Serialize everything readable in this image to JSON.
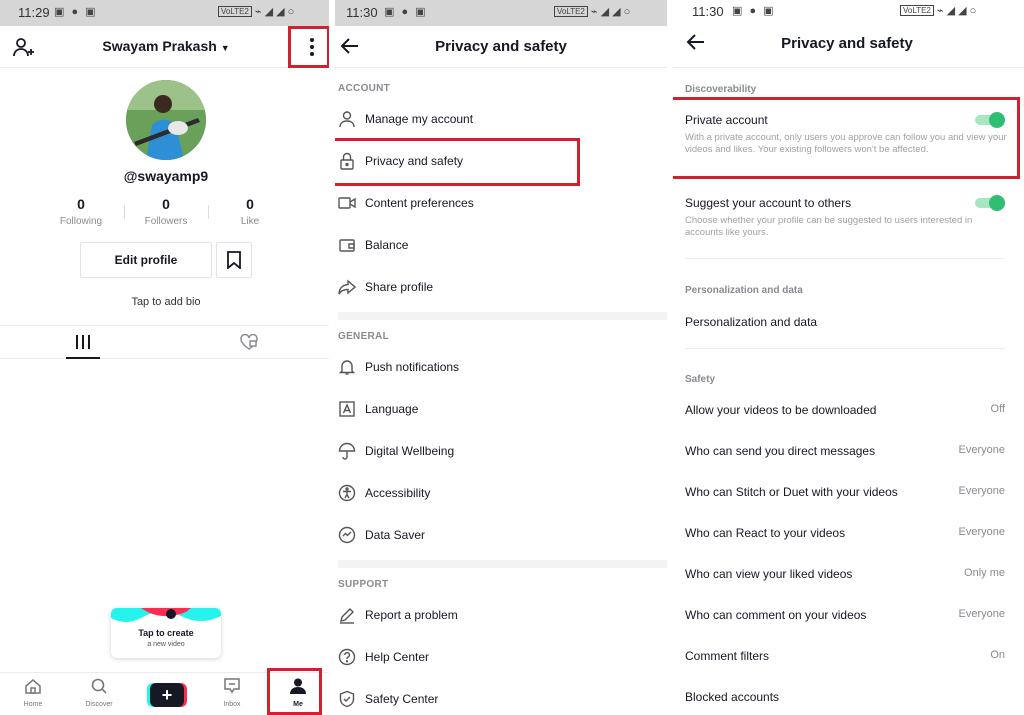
{
  "colors": {
    "highlight": "#d32030",
    "toggle_on": "#2fbe74",
    "toggle_track": "#a7e6c3",
    "text_primary": "#161823",
    "text_secondary": "#8a8b91"
  },
  "profile_screen": {
    "status_time": "11:29",
    "username": "Swayam Prakash",
    "handle": "@swayamp9",
    "stats": [
      {
        "value": "0",
        "label": "Following"
      },
      {
        "value": "0",
        "label": "Followers"
      },
      {
        "value": "0",
        "label": "Like"
      }
    ],
    "edit_profile_label": "Edit profile",
    "bio_placeholder": "Tap to add bio",
    "tooltip": {
      "title": "Tap to create",
      "subtitle": "a new video"
    },
    "nav": {
      "home": "Home",
      "discover": "Discover",
      "create": "+",
      "inbox": "Inbox",
      "me": "Me"
    }
  },
  "privacy_menu": {
    "status_time": "11:30",
    "title": "Privacy and safety",
    "sections": [
      {
        "header": "ACCOUNT",
        "items": [
          {
            "icon": "person-icon",
            "label": "Manage my account"
          },
          {
            "icon": "lock-icon",
            "label": "Privacy and safety"
          },
          {
            "icon": "video-icon",
            "label": "Content preferences"
          },
          {
            "icon": "wallet-icon",
            "label": "Balance"
          },
          {
            "icon": "share-icon",
            "label": "Share profile"
          }
        ]
      },
      {
        "header": "GENERAL",
        "items": [
          {
            "icon": "bell-icon",
            "label": "Push notifications"
          },
          {
            "icon": "language-icon",
            "label": "Language"
          },
          {
            "icon": "umbrella-icon",
            "label": "Digital Wellbeing"
          },
          {
            "icon": "accessibility-icon",
            "label": "Accessibility"
          },
          {
            "icon": "data-saver-icon",
            "label": "Data Saver"
          }
        ]
      },
      {
        "header": "SUPPORT",
        "items": [
          {
            "icon": "pencil-icon",
            "label": "Report a problem"
          },
          {
            "icon": "help-icon",
            "label": "Help Center"
          },
          {
            "icon": "shield-icon",
            "label": "Safety Center"
          }
        ]
      }
    ]
  },
  "privacy_settings": {
    "status_time": "11:30",
    "title": "Privacy and safety",
    "discoverability_header": "Discoverability",
    "private_account": {
      "label": "Private account",
      "desc": "With a private account, only users you approve can follow you and view your videos and likes. Your existing followers won't be affected.",
      "enabled": true
    },
    "suggest_account": {
      "label": "Suggest your account to others",
      "desc": "Choose whether your profile can be suggested to users interested in accounts like yours.",
      "enabled": true
    },
    "personalization_header": "Personalization and data",
    "personalization_item": "Personalization and data",
    "safety_header": "Safety",
    "safety_items": [
      {
        "label": "Allow your videos to be downloaded",
        "value": "Off"
      },
      {
        "label": "Who can send you direct messages",
        "value": "Everyone"
      },
      {
        "label": "Who can Stitch or Duet with your videos",
        "value": "Everyone"
      },
      {
        "label": "Who can React to your videos",
        "value": "Everyone"
      },
      {
        "label": "Who can view your liked videos",
        "value": "Only me"
      },
      {
        "label": "Who can comment on your videos",
        "value": "Everyone"
      },
      {
        "label": "Comment filters",
        "value": "On"
      },
      {
        "label": "Blocked accounts",
        "value": ""
      }
    ]
  }
}
